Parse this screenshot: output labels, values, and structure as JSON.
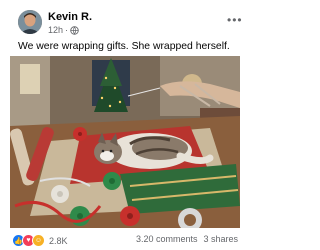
{
  "post": {
    "author": "Kevin R.",
    "time": "12h",
    "caption": "We were wrapping gifts. She wrapped herself.",
    "more_icon": "ellipsis-icon",
    "audience_icon": "globe-icon"
  },
  "photo": {
    "subject": "cat lying on wrapping paper with bows near a christmas tree"
  },
  "footer": {
    "reactions": [
      "like",
      "love",
      "haha"
    ],
    "reaction_count": "2.8K",
    "comments": "3.20 comments",
    "shares": "3 shares"
  },
  "colors": {
    "like": "#1877f2",
    "love": "#f33e58",
    "haha": "#f7b125",
    "secondary_text": "#65676b"
  }
}
